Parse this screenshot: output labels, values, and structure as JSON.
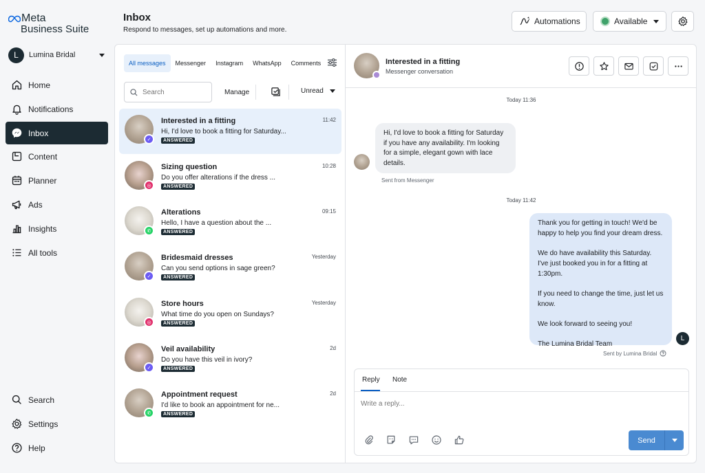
{
  "brand": {
    "line1": "Meta",
    "line2": "Business Suite"
  },
  "account": {
    "initial": "L",
    "name": "Lumina Bridal"
  },
  "nav": {
    "items": [
      {
        "label": "Home",
        "icon": "home-icon"
      },
      {
        "label": "Notifications",
        "icon": "bell-icon"
      },
      {
        "label": "Inbox",
        "icon": "messenger-icon"
      },
      {
        "label": "Content",
        "icon": "content-icon"
      },
      {
        "label": "Planner",
        "icon": "calendar-icon"
      },
      {
        "label": "Ads",
        "icon": "megaphone-icon"
      },
      {
        "label": "Insights",
        "icon": "bar-chart-icon"
      },
      {
        "label": "All tools",
        "icon": "list-icon"
      }
    ],
    "bottom": [
      {
        "label": "Search",
        "icon": "search-icon"
      },
      {
        "label": "Settings",
        "icon": "gear-icon"
      },
      {
        "label": "Help",
        "icon": "help-icon"
      }
    ]
  },
  "header": {
    "title": "Inbox",
    "subtitle": "Respond to messages, set up automations and more.",
    "automations_label": "Automations",
    "status_label": "Available"
  },
  "list": {
    "tabs": [
      "All messages",
      "Messenger",
      "Instagram",
      "WhatsApp",
      "Comments"
    ],
    "search_placeholder": "Search",
    "manage_label": "Manage",
    "filter_label": "Unread",
    "conversations": [
      {
        "title": "Interested in a fitting",
        "preview": "Hi, I'd love to book a fitting for Saturday...",
        "time": "11:42",
        "status": "ANSWERED",
        "channel": "messenger"
      },
      {
        "title": "Sizing question",
        "preview": "Do you offer alterations if the dress ...",
        "time": "10:28",
        "status": "ANSWERED",
        "channel": "instagram"
      },
      {
        "title": "Alterations",
        "preview": "Hello, I have a question about the ...",
        "time": "09:15",
        "status": "ANSWERED",
        "channel": "whatsapp"
      },
      {
        "title": "Bridesmaid dresses",
        "preview": "Can you send options in sage green?",
        "time": "Yesterday",
        "status": "ANSWERED",
        "channel": "messenger"
      },
      {
        "title": "Store hours",
        "preview": "What time do you open on Sundays?",
        "time": "Yesterday",
        "status": "ANSWERED",
        "channel": "instagram"
      },
      {
        "title": "Veil availability",
        "preview": "Do you have this veil in ivory?",
        "time": "2d",
        "status": "ANSWERED",
        "channel": "messenger"
      },
      {
        "title": "Appointment request",
        "preview": "I'd like to book an appointment for ne...",
        "time": "2d",
        "status": "ANSWERED",
        "channel": "whatsapp"
      }
    ]
  },
  "chat": {
    "title": "Interested in a fitting",
    "subtitle": "Messenger conversation",
    "stamp1": "Today 11:36",
    "incoming": "Hi, I'd love to book a fitting for Saturday if you have any availability. I'm looking for a simple, elegant gown with lace details.",
    "incoming_note": "Sent from Messenger",
    "stamp2": "Today 11:42",
    "outgoing": [
      "Thank you for getting in touch! We'd be happy to help you find your dream dress.",
      "We do have availability this Saturday. I've just booked you in for a fitting at 1:30pm.",
      "If you need to change the time, just let us know.",
      "We look forward to seeing you!",
      "The Lumina Bridal Team"
    ],
    "outgoing_note": "Sent by Lumina Bridal",
    "composer": {
      "tab_reply": "Reply",
      "tab_note": "Note",
      "placeholder": "Write a reply...",
      "send_label": "Send"
    }
  },
  "colors": {
    "nav_active": "#1c2b33",
    "accent": "#0a5ec2",
    "send": "#4a8ad1",
    "outgoing_bubble": "#dde8f8",
    "available": "#3fa26a"
  }
}
